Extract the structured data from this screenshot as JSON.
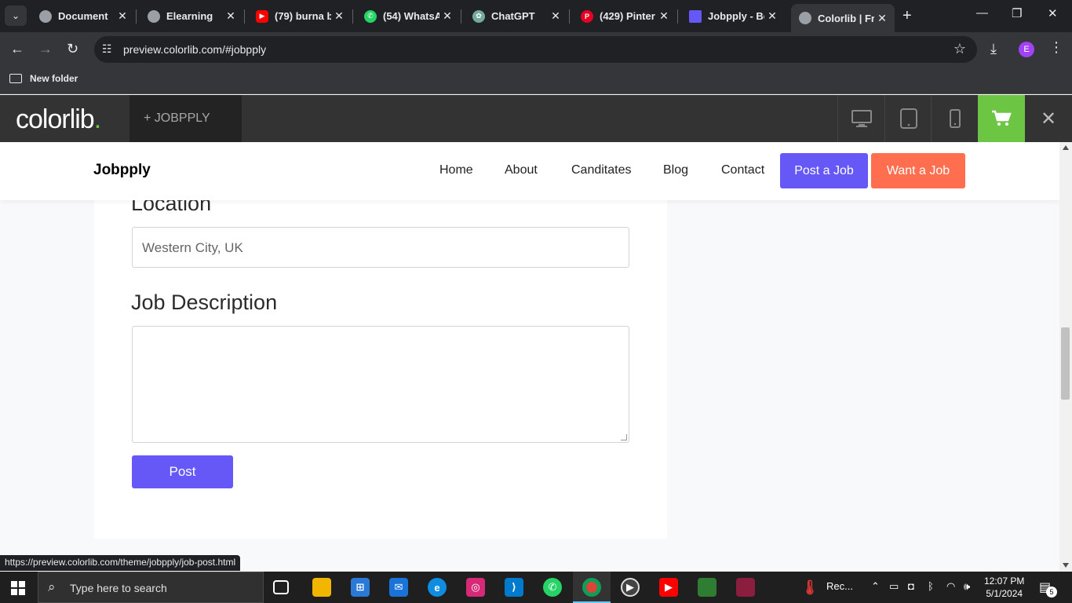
{
  "browser": {
    "tabs": [
      {
        "title": "Document",
        "favicon": "globe-icon",
        "color": "#9aa0a6"
      },
      {
        "title": "Elearning",
        "favicon": "globe-icon",
        "color": "#9aa0a6"
      },
      {
        "title": "(79) burna b",
        "favicon": "youtube-icon",
        "color": "#ff0000"
      },
      {
        "title": "(54) WhatsA",
        "favicon": "whatsapp-icon",
        "color": "#25d366"
      },
      {
        "title": "ChatGPT",
        "favicon": "chatgpt-icon",
        "color": "#74aa9c"
      },
      {
        "title": "(429) Pinter",
        "favicon": "pinterest-icon",
        "color": "#e60023"
      },
      {
        "title": "Jobpply - Be",
        "favicon": "colorlib-icon",
        "color": "#6658f6"
      },
      {
        "title": "Colorlib | Fr",
        "favicon": "globe-icon",
        "color": "#9aa0a6",
        "active": true
      }
    ],
    "url": "preview.colorlib.com/#jobpply",
    "profile_initial": "E",
    "bookmark_folder": "New folder",
    "status_url": "https://preview.colorlib.com/theme/jobpply/job-post.html"
  },
  "colorlib": {
    "logo_text": "colorlib",
    "logo_dot": ".",
    "theme_tab": "+  JOBPPLY"
  },
  "site": {
    "brand": "Jobpply",
    "nav": [
      "Home",
      "About",
      "Canditates",
      "Blog",
      "Contact"
    ],
    "post_job_label": "Post a Job",
    "want_job_label": "Want a Job",
    "accent": "#6658f6",
    "secondary": "#ff6e4f"
  },
  "form": {
    "location_label": "Location",
    "location_value": "Western City, UK",
    "description_label": "Job Description",
    "description_value": "",
    "submit_label": "Post"
  },
  "taskbar": {
    "search_placeholder": "Type here to search",
    "weather_label": "Rec...",
    "time": "12:07 PM",
    "date": "5/1/2024",
    "notification_count": "5"
  }
}
